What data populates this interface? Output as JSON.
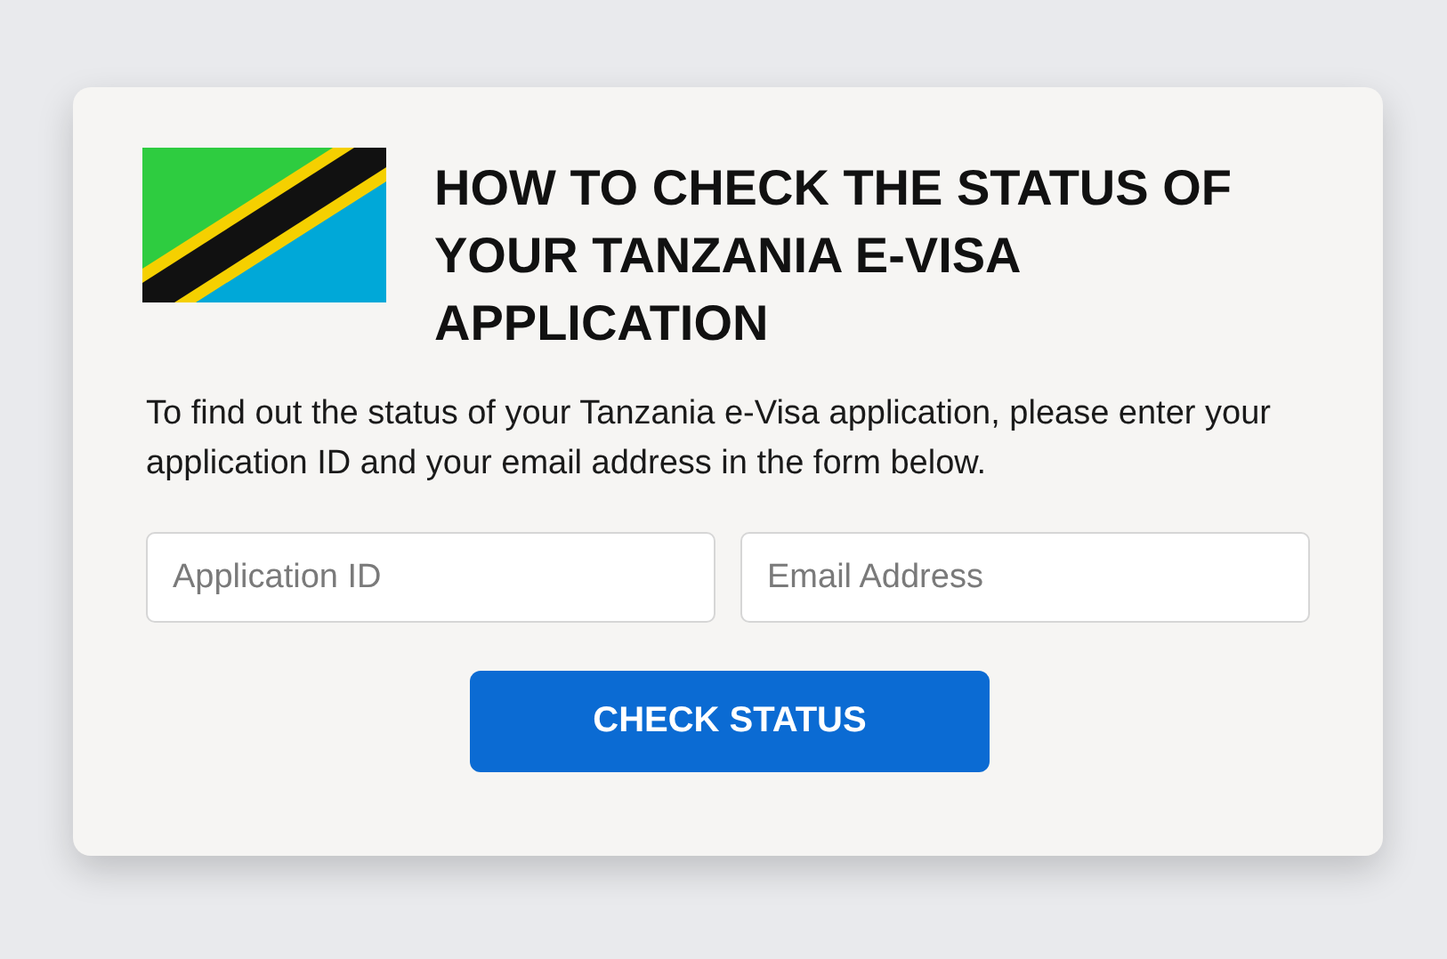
{
  "title": "HOW TO CHECK THE STATUS OF YOUR TANZANIA E-VISA APPLICATION",
  "description": "To find out the status of your Tanzania e-Visa application, please enter your application ID and your email address in the form below.",
  "fields": [
    {
      "placeholder": "Application ID"
    },
    {
      "placeholder": "Email Address"
    }
  ],
  "button": "CHECK STATUS"
}
